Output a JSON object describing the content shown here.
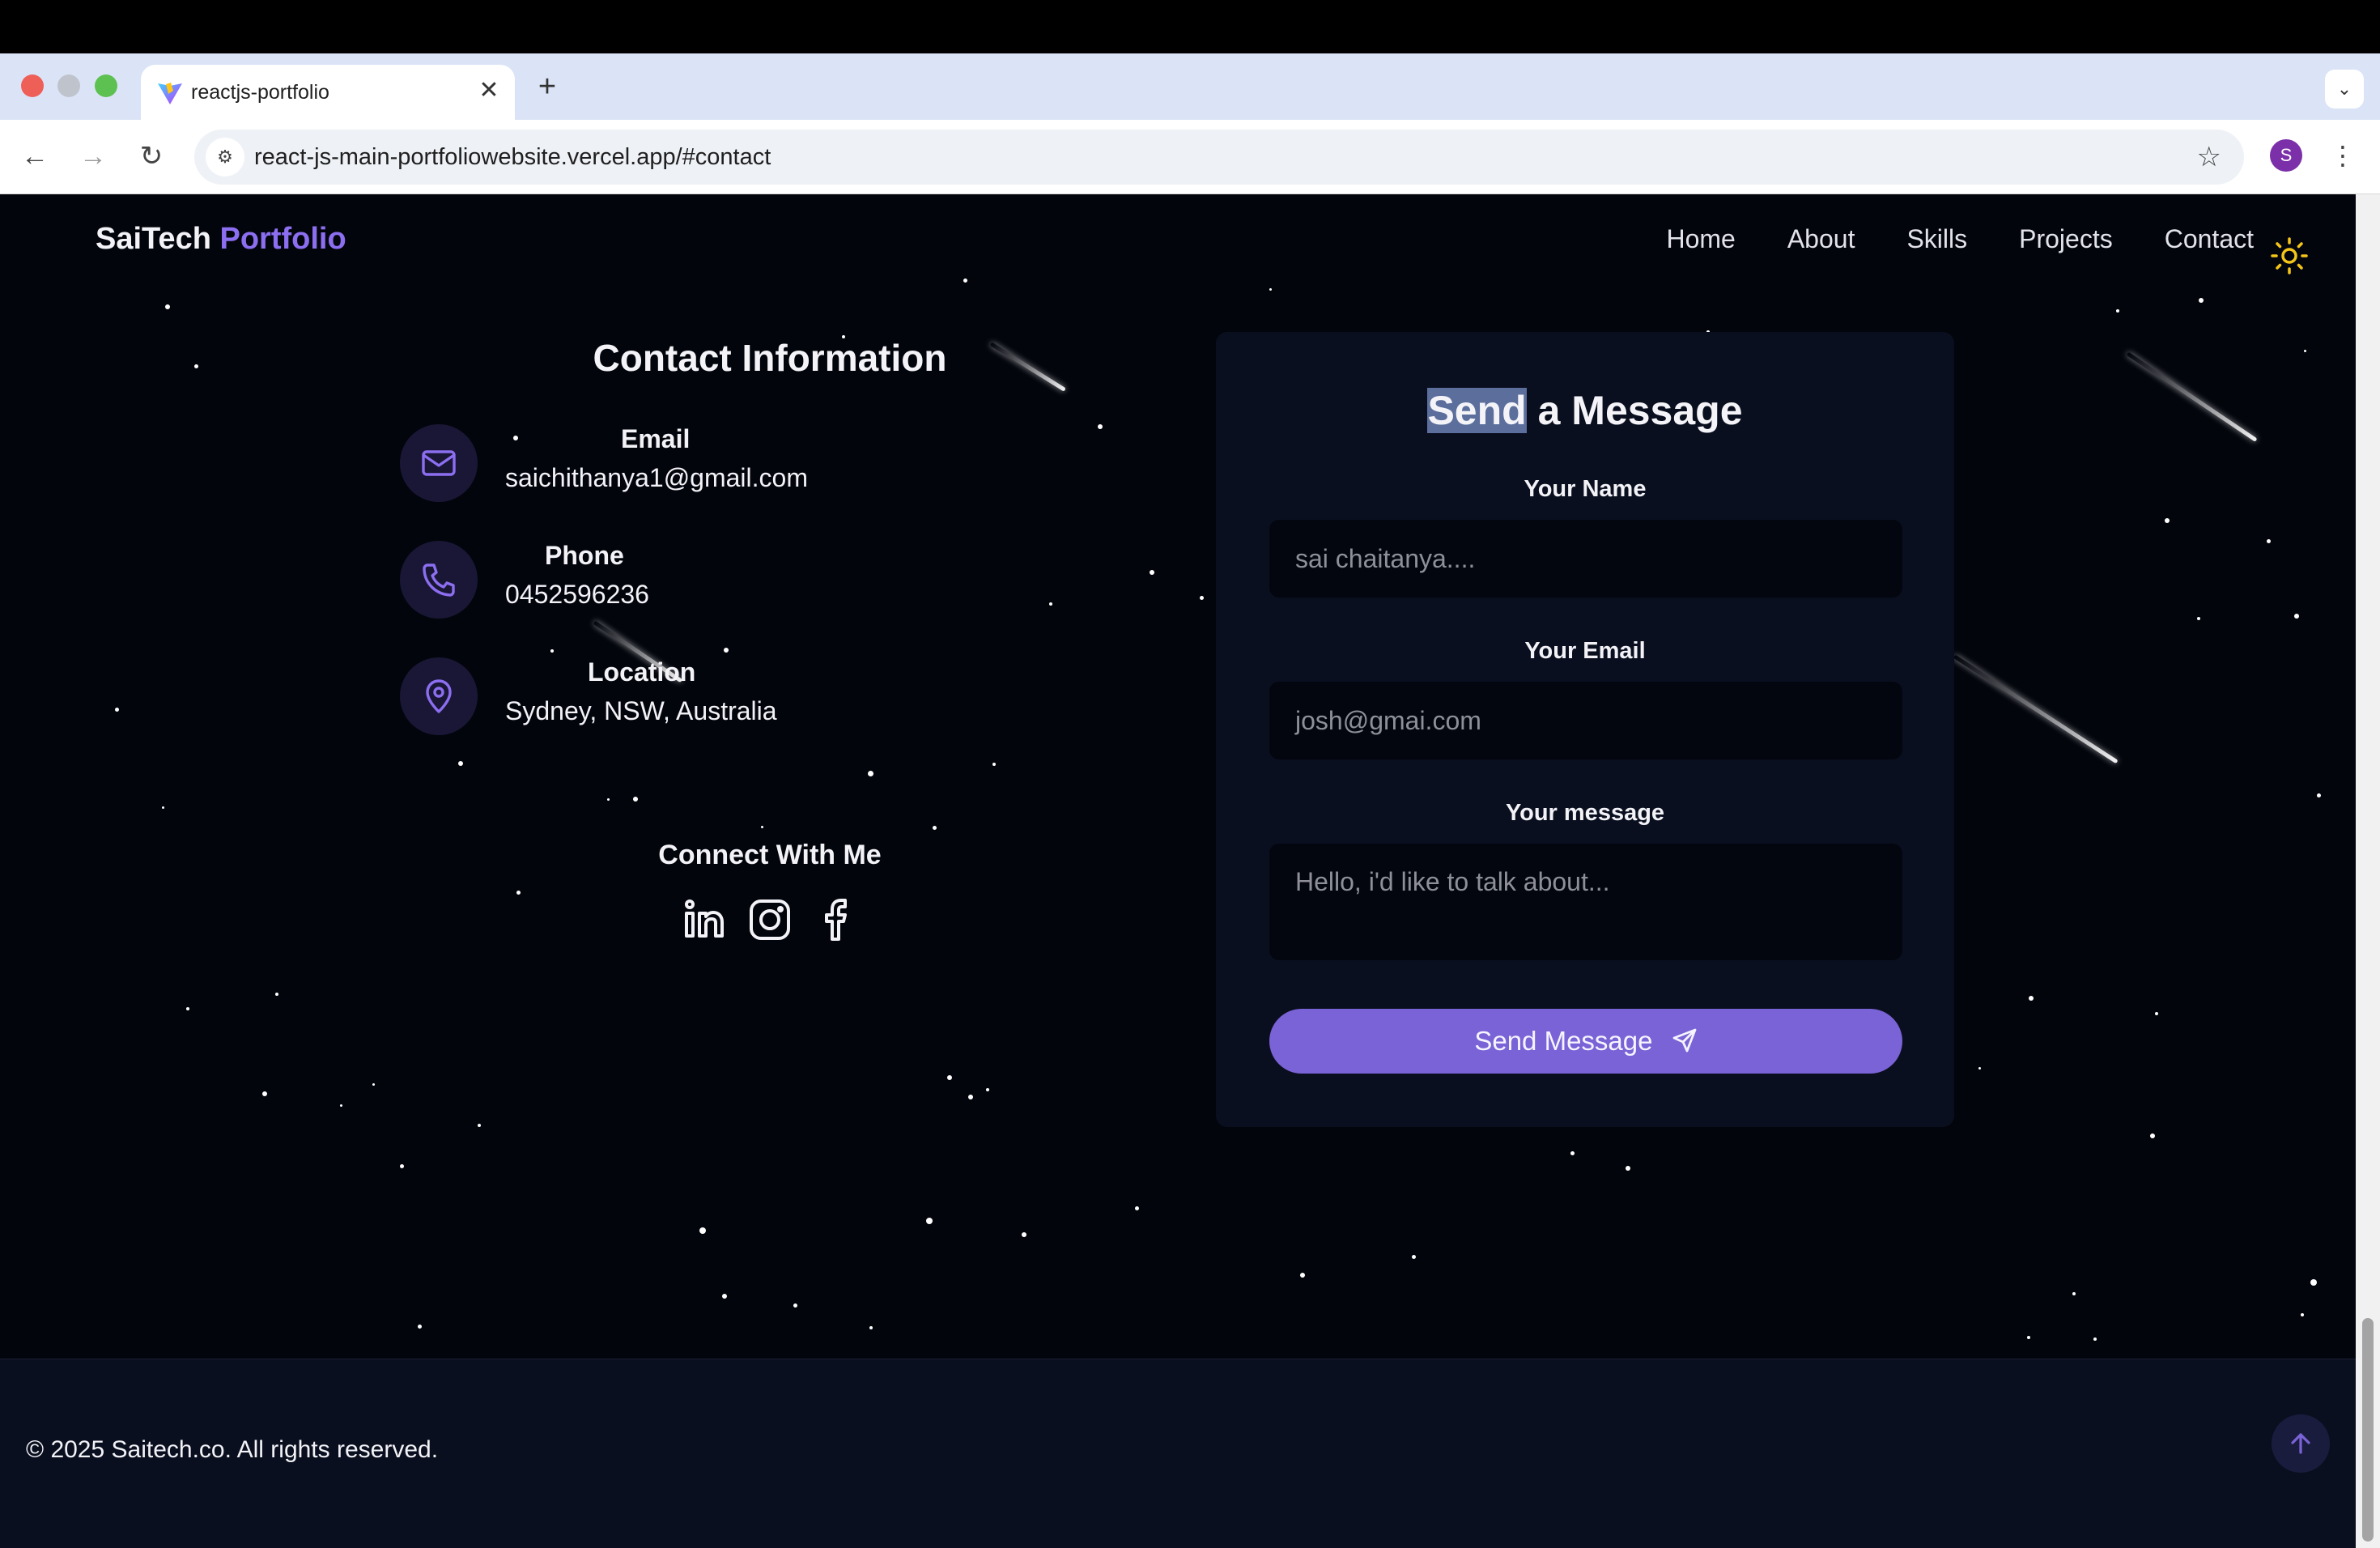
{
  "browser": {
    "tab_title": "reactjs-portfolio",
    "tab_close": "✕",
    "new_tab": "+",
    "url": "react-js-main-portfoliowebsite.vercel.app/#contact",
    "profile_initial": "S"
  },
  "navbar": {
    "brand_main": "SaiTech",
    "brand_accent": "Portfolio",
    "links": [
      "Home",
      "About",
      "Skills",
      "Projects",
      "Contact"
    ]
  },
  "contact_info": {
    "title": "Contact Information",
    "items": [
      {
        "label": "Email",
        "value": "saichithanya1@gmail.com",
        "icon": "mail-icon"
      },
      {
        "label": "Phone",
        "value": "0452596236",
        "icon": "phone-icon"
      },
      {
        "label": "Location",
        "value": "Sydney, NSW, Australia",
        "icon": "map-pin-icon"
      }
    ],
    "connect_title": "Connect With Me",
    "socials": [
      "linkedin-icon",
      "instagram-icon",
      "facebook-icon"
    ]
  },
  "form": {
    "title_selected": "Send",
    "title_rest": " a Message",
    "name_label": "Your Name",
    "name_placeholder": "sai chaitanya....",
    "email_label": "Your Email",
    "email_placeholder": "josh@gmai.com",
    "message_label": "Your message",
    "message_placeholder": "Hello, i'd like to talk about...",
    "submit_label": "Send Message"
  },
  "footer": {
    "copyright": "© 2025 Saitech.co. All rights reserved."
  },
  "colors": {
    "accent": "#7a63d6",
    "brand_accent": "#8c6ef0",
    "page_bg": "#03050d",
    "card_bg": "#0a0f1f",
    "sun": "#f5c518"
  }
}
